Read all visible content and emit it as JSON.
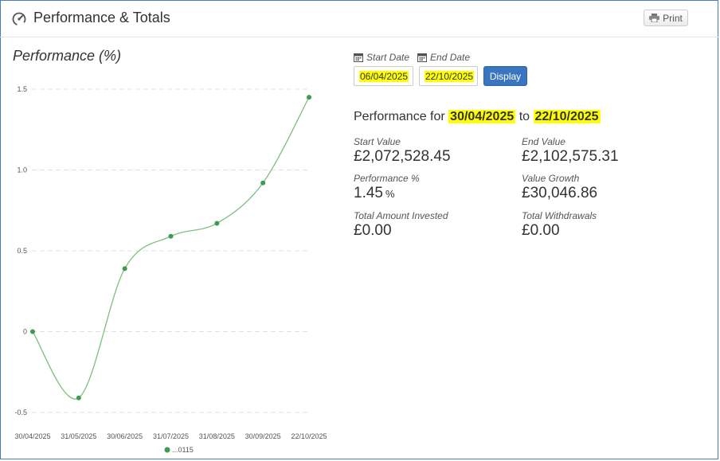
{
  "header": {
    "title": "Performance & Totals",
    "print_label": "Print"
  },
  "chart_title": "Performance (%)",
  "dates": {
    "start_label": "Start Date",
    "end_label": "End Date",
    "start_value": "06/04/2025",
    "end_value": "22/10/2025",
    "display_label": "Display"
  },
  "performance": {
    "prefix": "Performance for",
    "from": "30/04/2025",
    "connector": "to",
    "to": "22/10/2025"
  },
  "stats": {
    "start_value_label": "Start Value",
    "start_value": "£2,072,528.45",
    "end_value_label": "End Value",
    "end_value": "£2,102,575.31",
    "perf_label": "Performance %",
    "perf_value": "1.45",
    "perf_unit": "%",
    "growth_label": "Value Growth",
    "growth_value": "£30,046.86",
    "invested_label": "Total Amount Invested",
    "invested_value": "£0.00",
    "withdrawals_label": "Total Withdrawals",
    "withdrawals_value": "£0.00"
  },
  "colors": {
    "line": "#7cc07c",
    "point": "#3f9a4f",
    "grid": "#e0e0e0",
    "highlight": "#ffff00",
    "button": "#3a76c0",
    "frame": "#4a7cc4"
  },
  "chart_data": {
    "type": "line",
    "title": "Performance (%)",
    "x": [
      "30/04/2025",
      "31/05/2025",
      "30/06/2025",
      "31/07/2025",
      "31/08/2025",
      "30/09/2025",
      "22/10/2025"
    ],
    "series": [
      {
        "name": "...0115",
        "values": [
          0,
          -0.41,
          0.39,
          0.59,
          0.67,
          0.92,
          1.45
        ]
      }
    ],
    "yticks": [
      "1.5",
      "1.0",
      "0.5",
      "0",
      "-0.5"
    ],
    "ylim": [
      -0.5,
      1.5
    ],
    "grid": true,
    "legend": "bottom-center"
  }
}
